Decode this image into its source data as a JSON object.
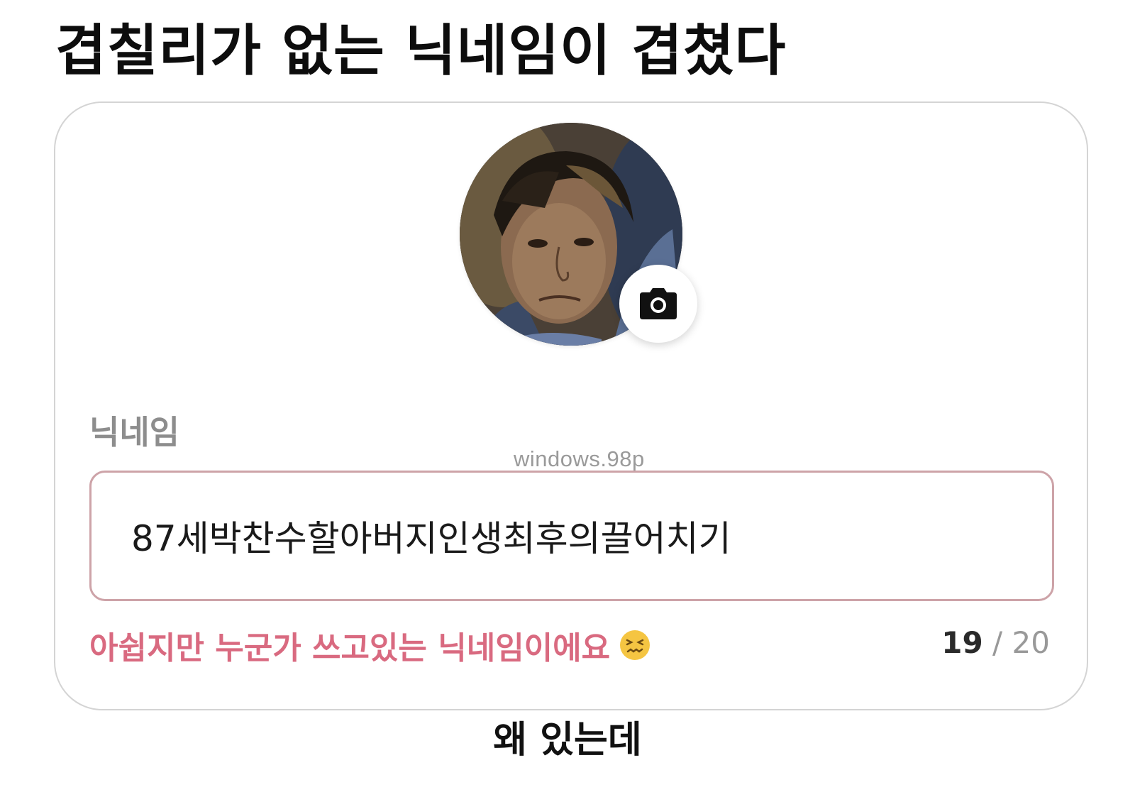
{
  "headline": "겹칠리가 없는 닉네임이 겹쳤다",
  "card": {
    "avatar": {
      "icon": "profile-photo"
    },
    "camera_button": {
      "icon": "camera-icon"
    },
    "field_label": "닉네임",
    "watermark": "windows.98p",
    "nickname_value": "87세박찬수할아버지인생최후의끌어치기",
    "error_message": "아쉽지만 누군가 쓰고있는 닉네임이에요",
    "error_emoji": "confounded-face-emoji",
    "char_count": "19",
    "char_separator": " / ",
    "char_max": "20",
    "colors": {
      "error_text": "#d96a80",
      "input_border": "#cda3a8",
      "label_text": "#8d8d8d"
    }
  },
  "caption": "왜 있는데"
}
